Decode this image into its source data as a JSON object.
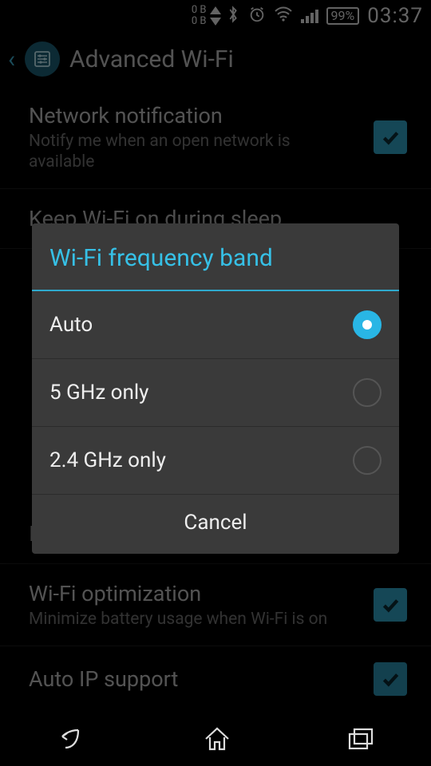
{
  "status": {
    "data_up": "0 B",
    "data_down": "0 B",
    "battery": "99%",
    "time": "03:37"
  },
  "header": {
    "title": "Advanced Wi-Fi"
  },
  "settings": {
    "net_notif": {
      "title": "Network notification",
      "sub": "Notify me when an open network is available"
    },
    "keep_on": {
      "title": "Keep Wi-Fi on during sleep"
    },
    "install": {
      "title": "Install certificates"
    },
    "optim": {
      "title": "Wi-Fi optimization",
      "sub": "Minimize battery usage when Wi-Fi is on"
    },
    "autoip": {
      "title": "Auto IP support"
    }
  },
  "dialog": {
    "title": "Wi-Fi frequency band",
    "options": [
      {
        "label": "Auto",
        "selected": true
      },
      {
        "label": "5 GHz only",
        "selected": false
      },
      {
        "label": "2.4 GHz only",
        "selected": false
      }
    ],
    "cancel": "Cancel"
  }
}
